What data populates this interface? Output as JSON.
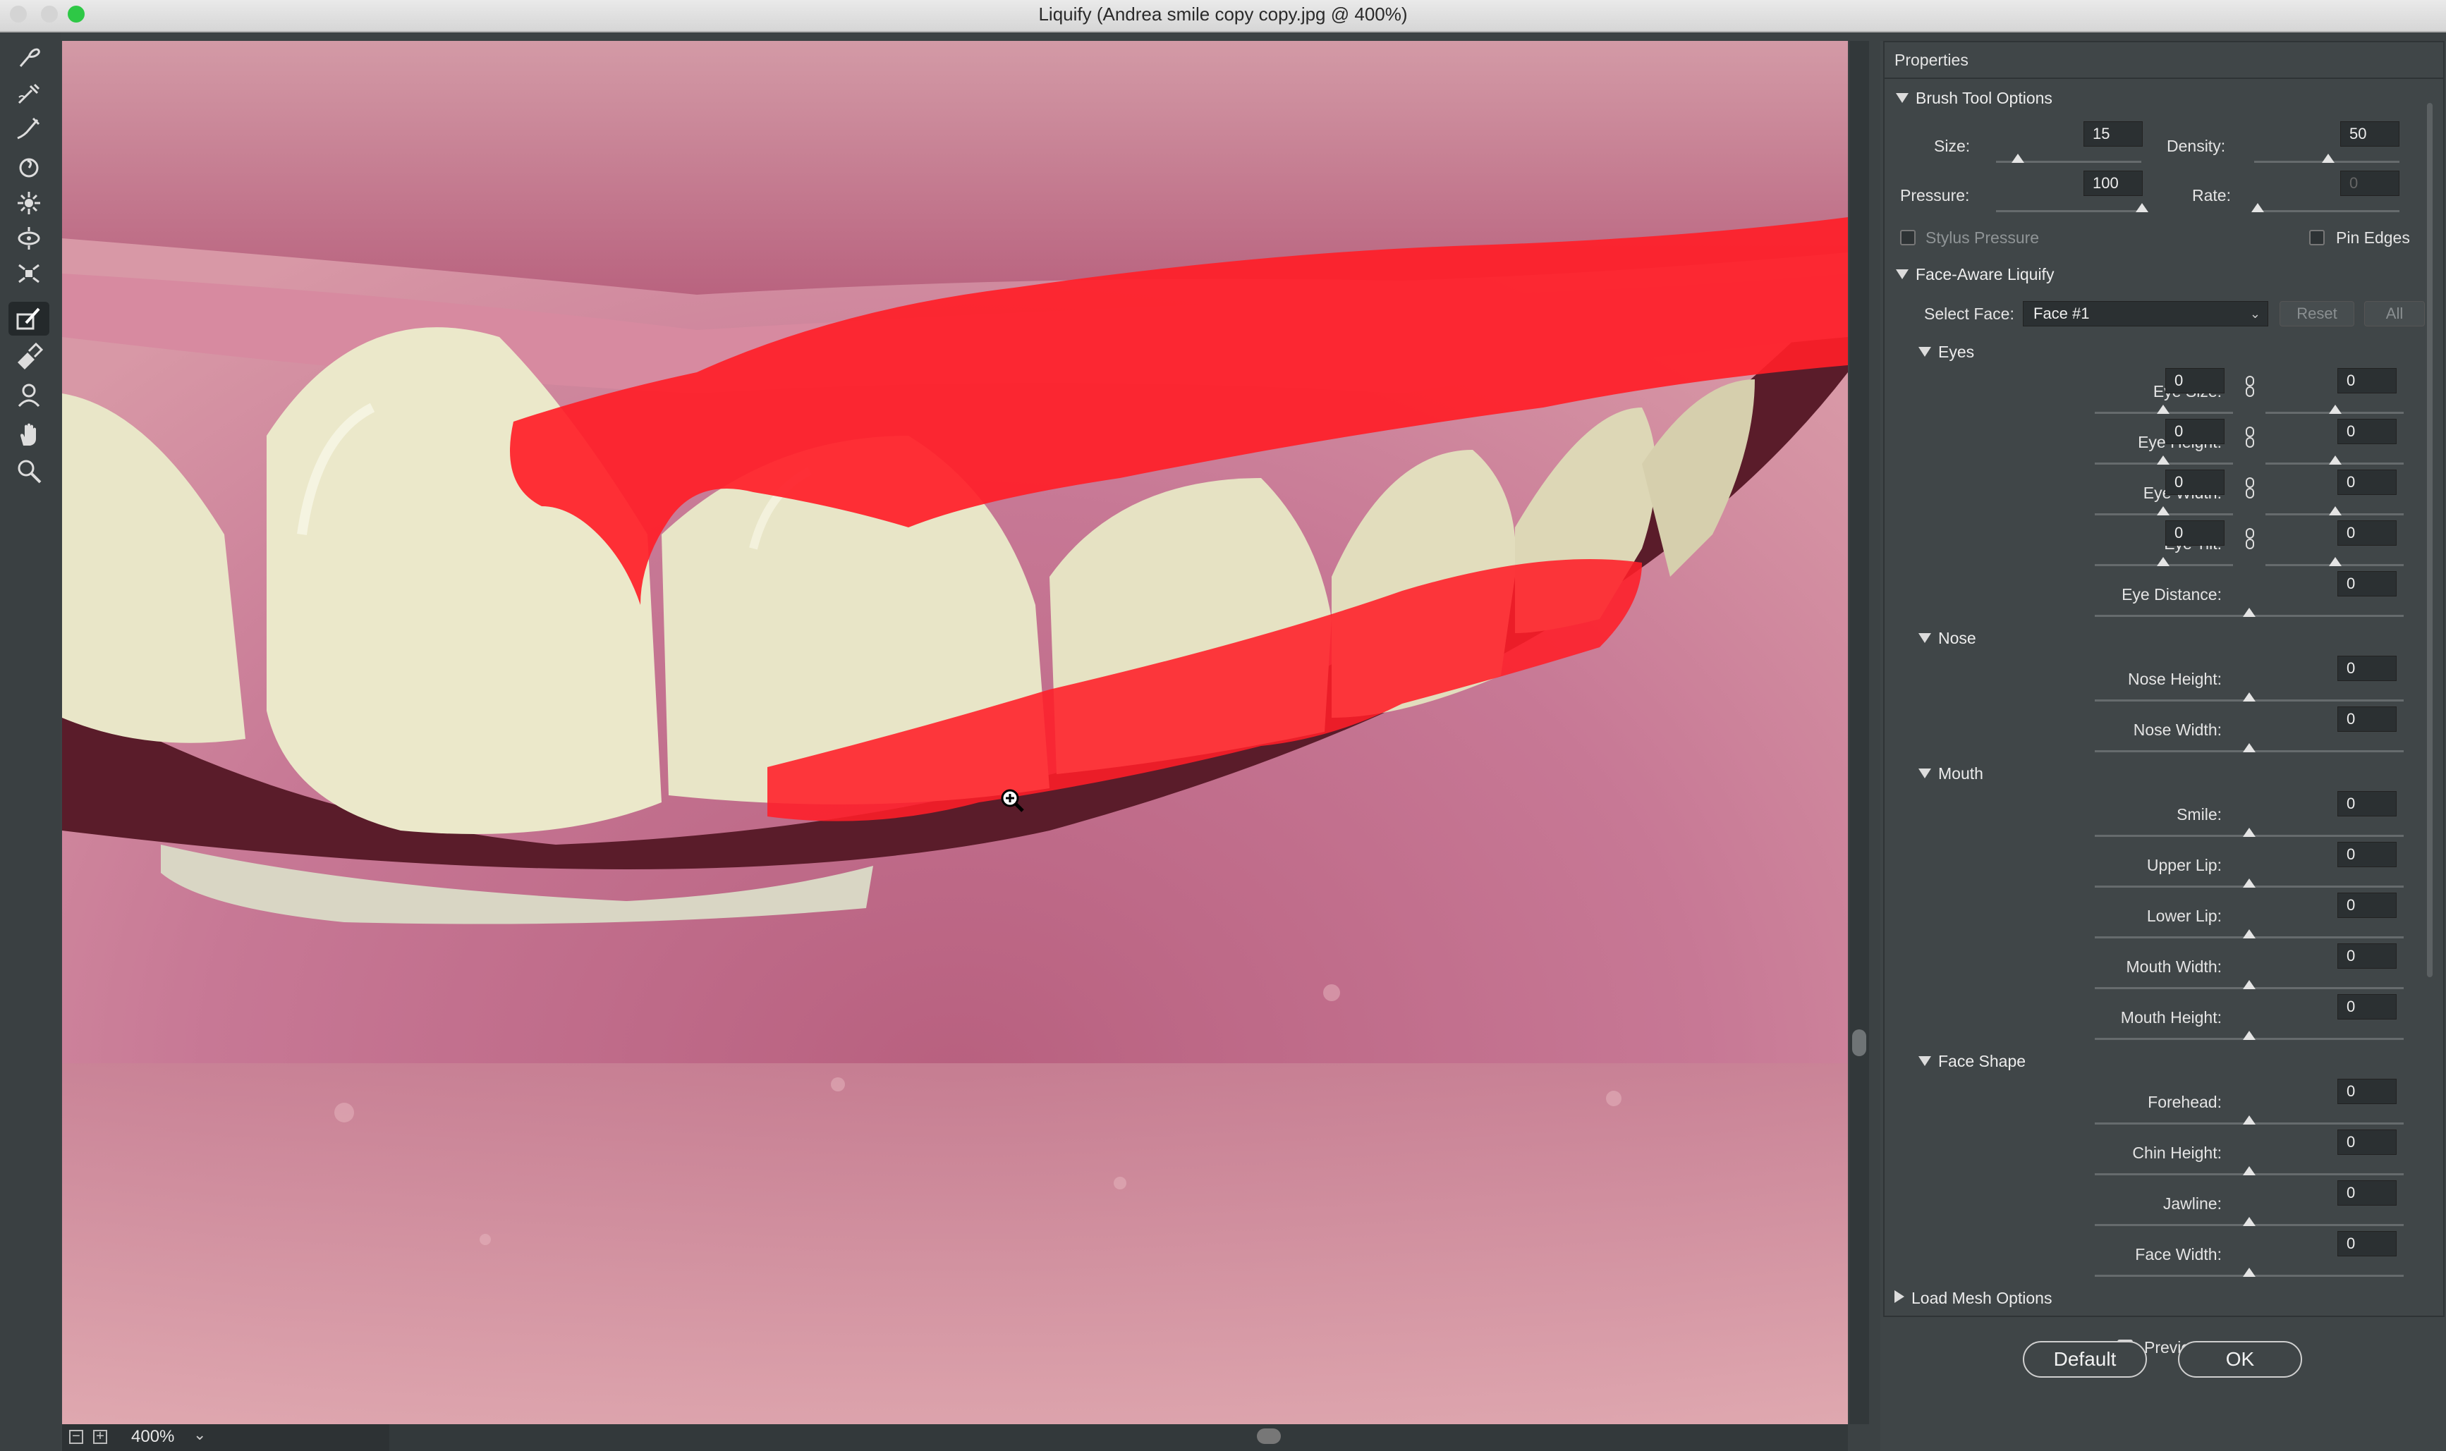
{
  "window": {
    "title": "Liquify (Andrea smile copy copy.jpg @ 400%)",
    "traffic_colors": [
      "#d4d4d4",
      "#d4d4d4",
      "#2ec846"
    ]
  },
  "toolbar": {
    "tools": [
      {
        "name": "forward-warp-tool",
        "icon": "forward-warp-icon"
      },
      {
        "name": "reconstruct-tool",
        "icon": "reconstruct-icon"
      },
      {
        "name": "smooth-tool",
        "icon": "smooth-icon"
      },
      {
        "name": "twirl-tool",
        "icon": "twirl-icon"
      },
      {
        "name": "pucker-tool",
        "icon": "pucker-icon"
      },
      {
        "name": "bloat-tool",
        "icon": "bloat-icon"
      },
      {
        "name": "push-left-tool",
        "icon": "push-left-icon"
      },
      {
        "name": "freeze-mask-tool",
        "icon": "freeze-mask-icon",
        "active": true
      },
      {
        "name": "thaw-mask-tool",
        "icon": "thaw-mask-icon"
      },
      {
        "name": "face-tool",
        "icon": "face-icon"
      },
      {
        "name": "hand-tool",
        "icon": "hand-icon"
      },
      {
        "name": "zoom-tool",
        "icon": "zoom-icon"
      }
    ]
  },
  "status": {
    "zoom": "400%"
  },
  "properties": {
    "header": "Properties",
    "brush": {
      "title": "Brush Tool Options",
      "size_label": "Size:",
      "size_value": "15",
      "density_label": "Density:",
      "density_value": "50",
      "pressure_label": "Pressure:",
      "pressure_value": "100",
      "rate_label": "Rate:",
      "rate_value": "0",
      "stylus_label": "Stylus Pressure",
      "pin_label": "Pin Edges"
    },
    "face": {
      "title": "Face-Aware Liquify",
      "select_label": "Select Face:",
      "select_value": "Face #1",
      "reset_label": "Reset",
      "all_label": "All",
      "eyes": {
        "title": "Eyes",
        "size_label": "Eye Size:",
        "size_l": "0",
        "size_r": "0",
        "height_label": "Eye Height:",
        "height_l": "0",
        "height_r": "0",
        "width_label": "Eye Width:",
        "width_l": "0",
        "width_r": "0",
        "tilt_label": "Eye Tilt:",
        "tilt_l": "0",
        "tilt_r": "0",
        "distance_label": "Eye Distance:",
        "distance": "0"
      },
      "nose": {
        "title": "Nose",
        "height_label": "Nose Height:",
        "height": "0",
        "width_label": "Nose Width:",
        "width": "0"
      },
      "mouth": {
        "title": "Mouth",
        "smile_label": "Smile:",
        "smile": "0",
        "upper_label": "Upper Lip:",
        "upper": "0",
        "lower_label": "Lower Lip:",
        "lower": "0",
        "width_label": "Mouth Width:",
        "width": "0",
        "height_label": "Mouth Height:",
        "height": "0"
      },
      "shape": {
        "title": "Face Shape",
        "forehead_label": "Forehead:",
        "forehead": "0",
        "chin_label": "Chin Height:",
        "chin": "0",
        "jawline_label": "Jawline:",
        "jawline": "0",
        "facewidth_label": "Face Width:",
        "facewidth": "0"
      }
    },
    "mesh": {
      "title": "Load Mesh Options"
    },
    "preview_label": "Preview",
    "default_label": "Default",
    "ok_label": "OK"
  },
  "colors": {
    "freeze_mask": "#ff1e28",
    "tooth": "#ece9cc",
    "lip": "#c97b92"
  }
}
